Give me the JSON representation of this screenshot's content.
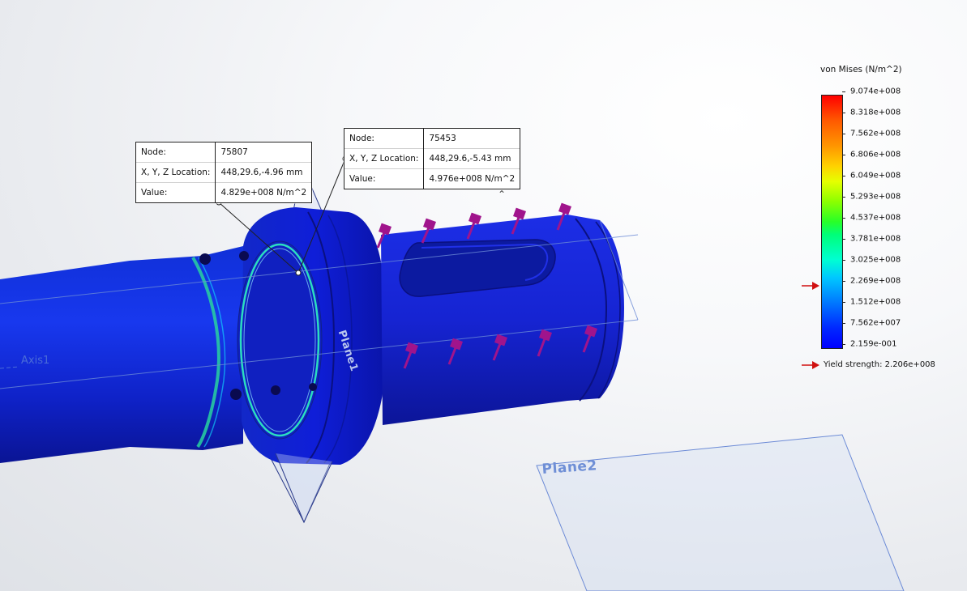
{
  "probes": [
    {
      "rows": [
        {
          "key": "Node:",
          "value": "75807"
        },
        {
          "key": "X, Y, Z Location:",
          "value": "448,29.6,-4.96 mm"
        },
        {
          "key": "Value:",
          "value": "4.829e+008 N/m^2"
        }
      ]
    },
    {
      "rows": [
        {
          "key": "Node:",
          "value": "75453"
        },
        {
          "key": "X, Y, Z Location:",
          "value": "448,29.6,-5.43 mm"
        },
        {
          "key": "Value:",
          "value": "4.976e+008 N/m^2"
        }
      ]
    }
  ],
  "legend": {
    "title": "von Mises (N/m^2)",
    "labels": [
      "9.074e+008",
      "8.318e+008",
      "7.562e+008",
      "6.806e+008",
      "6.049e+008",
      "5.293e+008",
      "4.537e+008",
      "3.781e+008",
      "3.025e+008",
      "2.269e+008",
      "1.512e+008",
      "7.562e+007",
      "2.159e-001"
    ],
    "yield_text": "Yield strength: 2.206e+008",
    "yield_fraction": 0.243,
    "arrow_color": "#d01010"
  },
  "labels": {
    "axis": "Axis1",
    "plane1": "Plane1",
    "plane2": "Plane2"
  },
  "icons": {
    "probe_collapse": "chevron-up-icon",
    "yield_marker": "red-arrow-icon"
  },
  "colors": {
    "shaft_blue": "#1a1ae0",
    "load_arrow": "#a0148c",
    "plane_edge": "#6b8ad6"
  }
}
